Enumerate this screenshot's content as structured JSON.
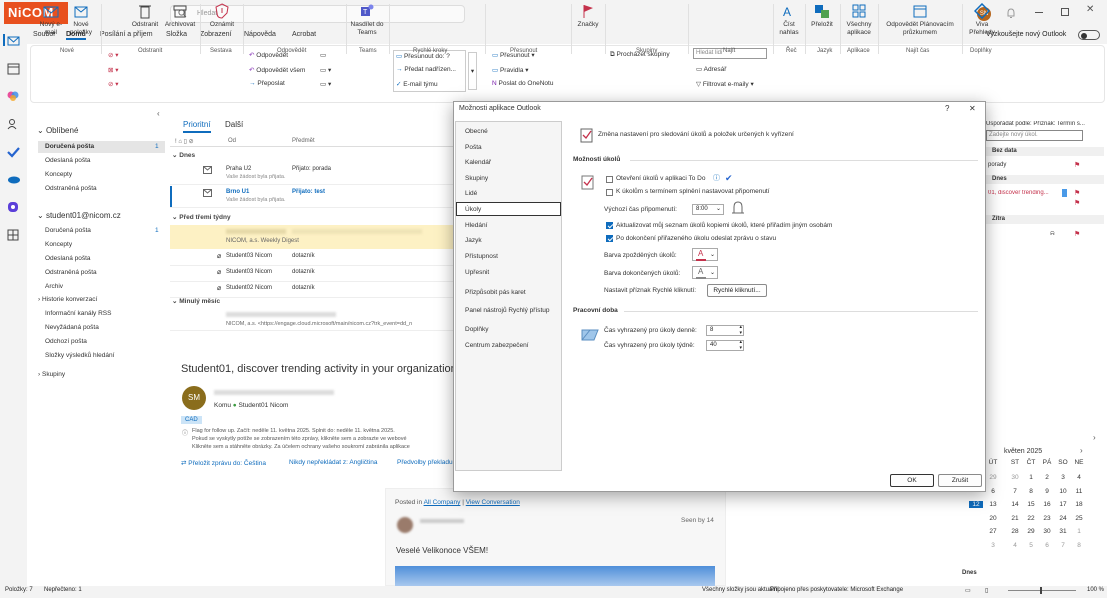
{
  "app": {
    "logo": "NiCOM",
    "search_placeholder": "Hledat",
    "avatar": "SN",
    "new_outlook": "Vyzkoušejte nový Outlook"
  },
  "menu": [
    "Soubor",
    "Domů",
    "Posílání a příjem",
    "Složka",
    "Zobrazení",
    "Nápověda",
    "Acrobat"
  ],
  "ribbon": {
    "new_email": "Nový e-mail",
    "new_items": "Nové položky",
    "grp_new": "Nové",
    "ignore": "Ignorovat",
    "delete": "Odstranit",
    "archive": "Archivovat",
    "grp_delete": "Odstranit",
    "report": "Oznámit",
    "grp_report": "Sestava",
    "reply": "Odpovědět",
    "reply_all": "Odpovědět všem",
    "forward": "Přeposlat",
    "grp_respond": "Odpovědět",
    "teams": "Nasdílet do Teams",
    "grp_teams": "Teams",
    "qs1": "Přesunout do: ?",
    "qs2": "Předat nadřízen...",
    "qs3": "E-mail týmu",
    "grp_quick": "Rychlé kroky",
    "move": "Přesunout",
    "rules": "Pravidla",
    "onenote": "Poslat do OneNotu",
    "grp_move": "Přesunout",
    "tags": "Značky",
    "browse_groups": "Procházet skupiny",
    "grp_groups": "Skupiny",
    "search_people": "Hledat lidi",
    "address_book": "Adresář",
    "filter_email": "Filtrovat e-maily",
    "grp_find": "Najít",
    "read_aloud": "Číst nahlas",
    "grp_speech": "Řeč",
    "translate": "Přeložit",
    "grp_lang": "Jazyk",
    "all_apps": "Všechny aplikace",
    "grp_apps": "Aplikace",
    "reply_scheduling": "Odpovědět Plánovacím průzkumem",
    "grp_find2": "Najít čas",
    "viva": "Viva Přehledy",
    "grp_addin": "Doplňky"
  },
  "folders": {
    "favorites": "Oblíbené",
    "fav_items": [
      {
        "n": "Doručená pošta",
        "c": "1"
      },
      {
        "n": "Odeslaná pošta",
        "c": ""
      },
      {
        "n": "Koncepty",
        "c": ""
      },
      {
        "n": "Odstraněná pošta",
        "c": ""
      }
    ],
    "account": "student01@nicom.cz",
    "acc_items": [
      {
        "n": "Doručená pošta",
        "c": "1"
      },
      {
        "n": "Koncepty",
        "c": ""
      },
      {
        "n": "Odeslaná pošta",
        "c": ""
      },
      {
        "n": "Odstraněná pošta",
        "c": ""
      },
      {
        "n": "Archiv",
        "c": ""
      },
      {
        "n": "Historie konverzací",
        "c": ""
      },
      {
        "n": "Informační kanály RSS",
        "c": ""
      },
      {
        "n": "Nevyžádaná pošta",
        "c": ""
      },
      {
        "n": "Odchozí pošta",
        "c": ""
      },
      {
        "n": "Složky výsledků hledání",
        "c": ""
      }
    ],
    "groups": "Skupiny"
  },
  "list": {
    "tab_focused": "Prioritní",
    "tab_other": "Další",
    "col_from": "Od",
    "col_subject": "Předmět",
    "g_today": "Dnes",
    "g_weeks": "Před třemi týdny",
    "g_month": "Minulý měsíc",
    "r1_from": "Praha U2",
    "r1_subj": "Přijato: porada",
    "r1_prev": "Vaše žádost byla přijata.",
    "r2_from": "Brno U1",
    "r2_subj": "Přijato: test",
    "r2_prev": "Vaše žádost byla přijata.",
    "r3_from": "NICOM, a.s. Weekly Digest",
    "r4_from": "Student03 Nicom",
    "r4_subj": "dotazník",
    "r5_from": "Student02 Nicom",
    "r5_subj": "dotazník",
    "r6_prev": "NICOM, a.s. <https://engage.cloud.microsoft/main/nicom.cz?trk_event=dd_n"
  },
  "reading": {
    "subject": "Student01, discover trending activity in your organization",
    "avatar": "SM",
    "to_label": "Komu",
    "to": "Student01 Nicom",
    "tag": "CAD",
    "flag": "Flag for follow up. Začít: neděle 11. května 2025. Splnit do: neděle 11. května 2025.",
    "warn": "Pokud se vyskytly potíže se zobrazením této zprávy, klikněte sem a zobrazte ve webové",
    "warn2": "Klikněte sem a stáhněte obrázky. Za účelem ochrany vašeho soukromí zabránila aplikace",
    "tr1": "Přeložit zprávu do: Čeština",
    "tr2": "Nikdy nepřekládat z: Angličtina",
    "tr3": "Předvolby překladu",
    "posted": "Posted in",
    "all_company": "All Company",
    "view_conv": "View Conversation",
    "seen": "Seen by 14",
    "greeting": "Veselé Velikonoce VŠEM!"
  },
  "right": {
    "sort": "Uspořádat podle: Příznak: Termín s...",
    "new_task": "Zadejte nový úkol.",
    "nodate": "Bez data",
    "task1": "porady",
    "today": "Dnes",
    "task2": "01, discover trending...",
    "tomorrow": "Zítra"
  },
  "calendar": {
    "month": "květen 2025",
    "days": [
      "ÚT",
      "ST",
      "ČT",
      "PÁ",
      "SO",
      "NE"
    ],
    "weeks": [
      [
        "29",
        "30",
        "1",
        "2",
        "3",
        "4"
      ],
      [
        "6",
        "7",
        "8",
        "9",
        "10",
        "11"
      ],
      [
        "13",
        "14",
        "15",
        "16",
        "17",
        "18"
      ],
      [
        "20",
        "21",
        "22",
        "23",
        "24",
        "25"
      ],
      [
        "27",
        "28",
        "29",
        "30",
        "31",
        "1"
      ],
      [
        "3",
        "4",
        "5",
        "6",
        "7",
        "8"
      ]
    ],
    "selected_left": "12",
    "today_label": "Dnes"
  },
  "status": {
    "items": "Položky: 7",
    "unread": "Nepřečteno: 1",
    "updated": "Všechny složky jsou aktuální.",
    "connected": "Připojeno přes poskytovatele: Microsoft Exchange",
    "zoom": "100 %"
  },
  "dialog": {
    "title": "Možnosti aplikace Outlook",
    "help": "?",
    "close": "✕",
    "nav": [
      "Obecné",
      "Pošta",
      "Kalendář",
      "Skupiny",
      "Lidé",
      "Úkoly",
      "Hledání",
      "Jazyk",
      "Přístupnost",
      "Upřesnit",
      "Přizpůsobit pás karet",
      "Panel nástrojů Rychlý přístup",
      "Doplňky",
      "Centrum zabezpečení"
    ],
    "intro": "Změna nastavení pro sledování úkolů a položek určených k vyřízení",
    "sec_options": "Možnosti úkolů",
    "opt1": "Otevření úkolů v aplikaci To Do",
    "opt2": "K úkolům s termínem splnění nastavovat připomenutí",
    "reminder_time_label": "Výchozí čas připomenutí:",
    "reminder_time": "8:00",
    "opt3": "Aktualizovat můj seznam úkolů kopiemi úkolů, které přiřadím jiným osobám",
    "opt4": "Po dokončení přiřazeného úkolu odeslat zprávu o stavu",
    "overdue": "Barva zpožděných úkolů:",
    "completed": "Barva dokončených úkolů:",
    "quickclick_label": "Nastavit příznak Rychlé kliknutí:",
    "quickclick_btn": "Rychlé kliknutí...",
    "sec_work": "Pracovní doba",
    "daily_label": "Čas vyhrazený pro úkoly denně:",
    "daily": "8",
    "weekly_label": "Čas vyhrazený pro úkoly týdně:",
    "weekly": "40",
    "ok": "OK",
    "cancel": "Zrušit"
  }
}
